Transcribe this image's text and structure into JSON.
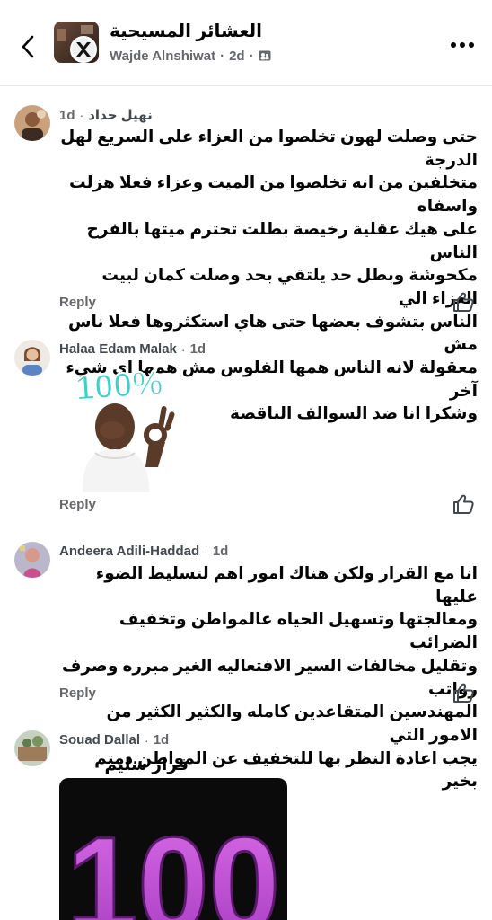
{
  "header": {
    "group_name": "العشائر المسيحية",
    "author": "Wajde Alnshiwat",
    "time": "2d",
    "back_icon": "chevron-left-icon",
    "more_icon": "more-dots-icon",
    "audience_icon": "group-audience-icon"
  },
  "comments": [
    {
      "author": "نهيل حداد",
      "time": "1d",
      "text_lines": [
        "حتى وصلت لهون تخلصوا من العزاء على السريع لهل الدرجة",
        "متخلفين من انه تخلصوا من الميت وعزاء فعلا هزلت واسفاه",
        "على هيك عقلية رخيصة بطلت تحترم ميتها بالفرح الناس",
        "مكحوشة وبطل حد يلتقي بحد وصلت كمان لبيت العزاء الي",
        "الناس بتشوف بعضها حتى هاي استكثروها فعلا ناس مش",
        "معقولة لانه الناس همها الفلوس مش همها اي شيء آخر",
        "وشكرا انا ضد السوالف الناقصة"
      ],
      "reply_label": "Reply"
    },
    {
      "author": "Halaa Edam Malak",
      "time": "1d",
      "sticker_text": "100%",
      "reply_label": "Reply"
    },
    {
      "author": "Andeera Adili-Haddad",
      "time": "1d",
      "text_lines": [
        "انا مع القرار ولكن هناك امور اهم لتسليط الضوء عليها",
        "ومعالجتها وتسهيل الحياه عالمواطن وتخفيف الضرائب",
        "وتقليل مخالفات السير الافتعاليه الغير مبرره وصرف رواتب",
        "المهندسين المتقاعدين كامله  والكثير الكثير من الامور التي",
        "يجب اعادة النظر بها للتخفيف عن المواطن.دمتم بخير"
      ],
      "reply_label": "Reply"
    },
    {
      "author": "Souad Dallal",
      "time": "1d",
      "text": "قرار سليم",
      "image_text": "100"
    }
  ],
  "icons": {
    "like": "thumbs-up-icon"
  },
  "colors": {
    "secondary_text": "#65676b",
    "divider": "#e4e6eb",
    "sticker_teal": "#3fd0c9",
    "image_purple": "#c14bd8"
  }
}
